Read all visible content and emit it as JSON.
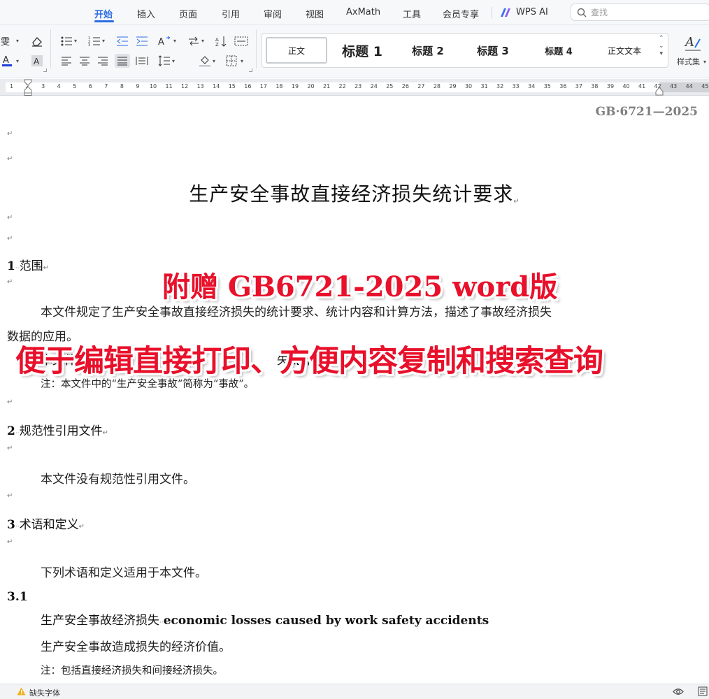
{
  "menu": {
    "tabs": [
      "开始",
      "插入",
      "页面",
      "引用",
      "审阅",
      "视图",
      "AxMath",
      "工具",
      "会员专享"
    ],
    "active_tab": "开始",
    "wps_ai": "WPS AI",
    "search_placeholder": "查找"
  },
  "ribbon": {
    "styles": [
      "正文",
      "标题 1",
      "标题 2",
      "标题 3",
      "标题 4",
      "正文文本"
    ],
    "selected_style": "正文",
    "style_set_label": "样式集",
    "accent_color": "#2b6de5",
    "font_color_bar": "#1f3fd6"
  },
  "ruler": {
    "ticks": [
      "1",
      "2",
      "3",
      "4",
      "5",
      "6",
      "7",
      "8",
      "9",
      "10",
      "11",
      "12",
      "13",
      "14",
      "15",
      "16",
      "17",
      "18",
      "19",
      "20",
      "21",
      "22",
      "23",
      "24",
      "25",
      "26",
      "27",
      "28",
      "29",
      "30",
      "31",
      "32",
      "33",
      "34",
      "35",
      "36",
      "37",
      "38",
      "39",
      "40",
      "41",
      "42",
      "43",
      "44",
      "45"
    ]
  },
  "document": {
    "header_code": "GB·6721—2025",
    "title": "生产安全事故直接经济损失统计要求",
    "sections": [
      {
        "number": "1",
        "title": "范围"
      },
      {
        "number": "2",
        "title": "规范性引用文件"
      },
      {
        "number": "3",
        "title": "术语和定义"
      }
    ],
    "scope_line1": "本文件规定了生产安全事故直接经济损失的统计要求、统计内容和计算方法，描述了事故经济损失",
    "scope_line2": "数据的应用。",
    "scope_line3_prefix": "本文件",
    "scope_line3_suffix": "失统计",
    "scope_note": "注：本文件中的“生产安全事故”简称为“事故”。",
    "refs_text": "本文件没有规范性引用文件。",
    "terms_intro": "下列术语和定义适用于本文件。",
    "term_number": "3.1",
    "term_zh": "生产安全事故经济损失",
    "term_en": "economic losses caused by work safety accidents",
    "term_definition": "生产安全事故造成损失的经济价值。",
    "term_note": "注：包括直接经济损失和间接经济损失。",
    "para_mark": "↵"
  },
  "promo": {
    "line1": "附赠 GB6721-2025 word版",
    "line2": "便于编辑直接打印、方便内容复制和搜索查询",
    "color": "#e8102a"
  },
  "status": {
    "missing_font": "缺失字体"
  }
}
